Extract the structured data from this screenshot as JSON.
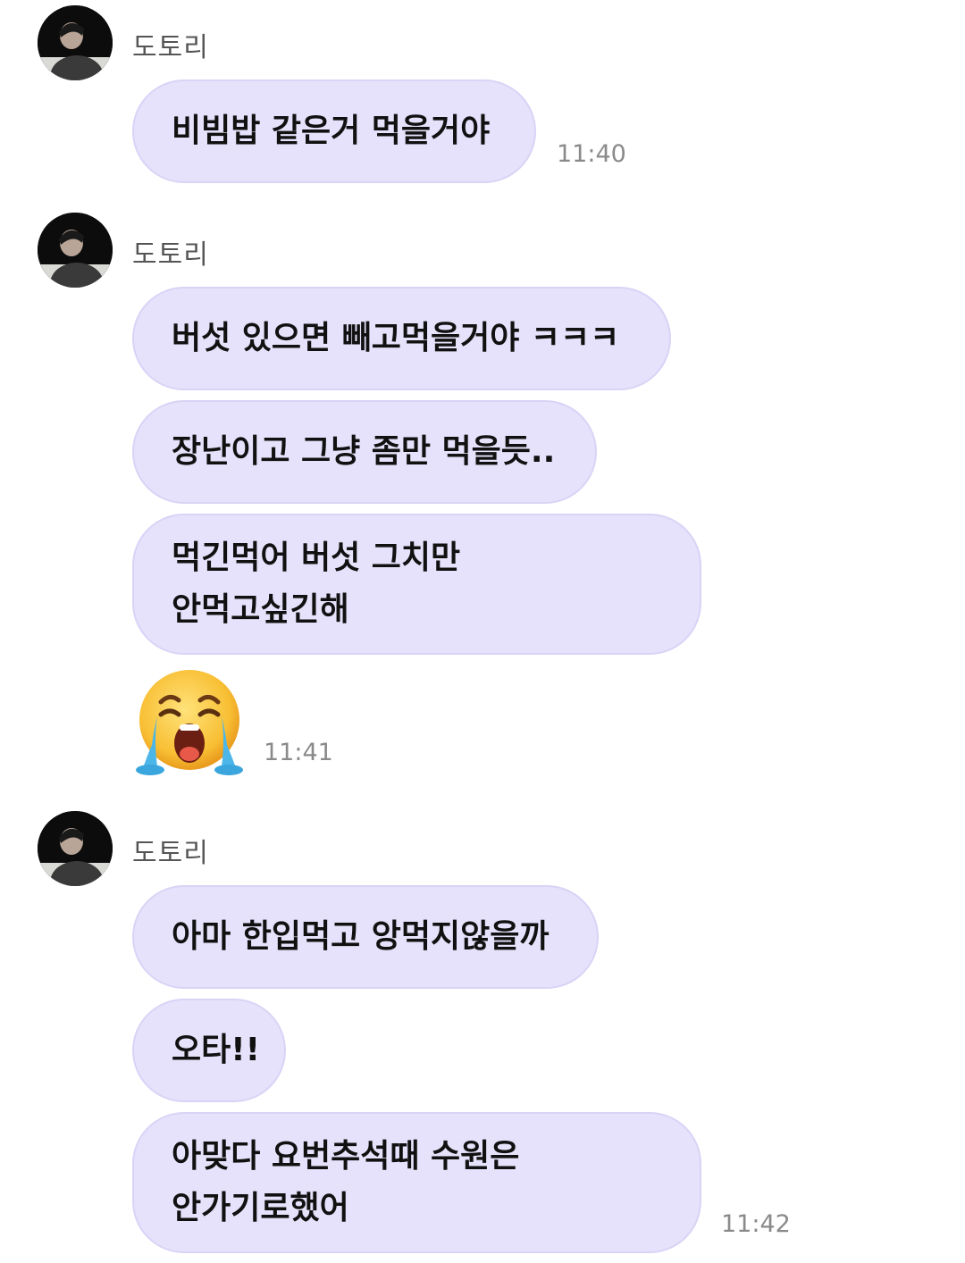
{
  "groups": [
    {
      "sender": "도토리",
      "messages": [
        {
          "text": "비빔밥 같은거 먹을거야"
        }
      ],
      "time": "11:40"
    },
    {
      "sender": "도토리",
      "messages": [
        {
          "text": "버섯 있으면 빼고먹을거야 ㅋㅋㅋ"
        },
        {
          "text": "장난이고 그냥 좀만 먹을듯.."
        },
        {
          "line1": "먹긴먹어 버섯 그치만",
          "line2": "안먹고싶긴해"
        }
      ],
      "sticker": "loudly-crying-face-emoji",
      "time": "11:41"
    },
    {
      "sender": "도토리",
      "messages": [
        {
          "text": "아마 한입먹고 앙먹지않을까"
        },
        {
          "text": "오타!!"
        },
        {
          "line1": "아맞다 요번추석때 수원은",
          "line2": "안가기로했어"
        }
      ],
      "time": "11:42"
    }
  ],
  "colors": {
    "bubble": "#e6e2fb",
    "bubble_border": "#d9d3f6",
    "text": "#111111",
    "sender": "#555555",
    "time": "#8a8a8a"
  }
}
